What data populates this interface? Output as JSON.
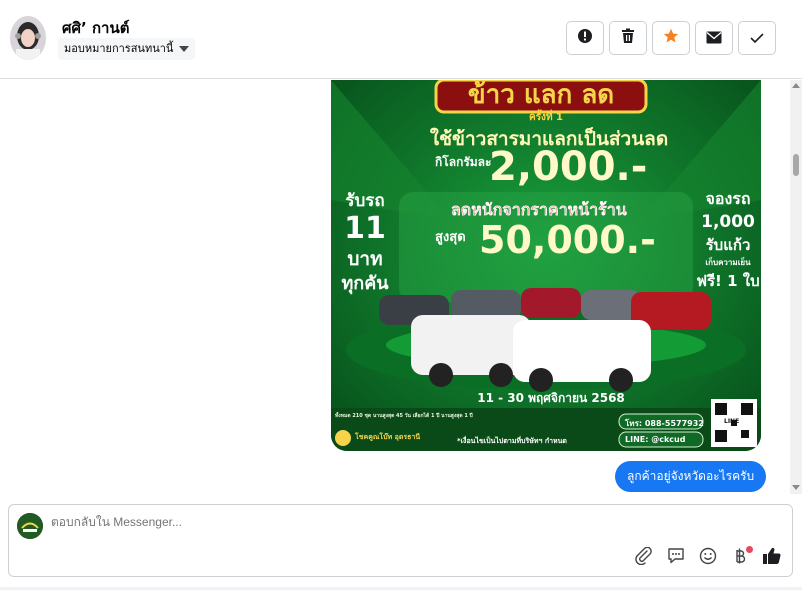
{
  "contact": {
    "name": "ศศิ’ กานต์",
    "assignment": "มอบหมายการสนทนานี้"
  },
  "header_actions": [
    {
      "name": "report-icon"
    },
    {
      "name": "trash-icon"
    },
    {
      "name": "star-icon"
    },
    {
      "name": "envelope-icon"
    },
    {
      "name": "check-icon"
    }
  ],
  "poster": {
    "title_top": "ข้าว แลก ลด",
    "round": "ครั้งที่ 1",
    "headline": "ใช้ข้าวสารมาแลกเป็นส่วนลด",
    "per_kg": "กิโลกรัมละ",
    "per_kg_value": "2,000.-",
    "left_promo": [
      "รับรถ",
      "11",
      "บาท",
      "ทุกคัน"
    ],
    "discount_label": "ลดหนักจากราคาหน้าร้าน",
    "max_label": "สูงสุด",
    "max_value": "50,000.-",
    "right_promo": [
      "จองรถ",
      "1,000",
      "รับแก้ว",
      "เก็บความเย็น",
      "ฟรี! 1 ใบ"
    ],
    "dates": "11 - 30 พฤศจิกายน 2568",
    "phone": "โทร: 088-5577932",
    "line_id": "LINE: @ckcud",
    "footnote": "*เงื่อนไขเป็นไปตามที่บริษัทฯ กำหนด",
    "qr_label": "LINE",
    "dealer": "โชคคูณโบ๊ท อุดรธานี",
    "small_stats": "ทั้งหมด 210 ชุด  นานสูงสุด 45 วัน  เลือกได้ 1 ปี  นานสูงสุด 1 ปี"
  },
  "messages": [
    {
      "text": "ลูกค้าอยู่จังหวัดอะไรครับ",
      "from": "page"
    }
  ],
  "composer": {
    "placeholder": "ตอบกลับใน Messenger..."
  },
  "colors": {
    "primary": "#1877f2",
    "star": "#f5821f",
    "poster_green": "#0d7a2d",
    "poster_gold": "#f6d44a"
  }
}
